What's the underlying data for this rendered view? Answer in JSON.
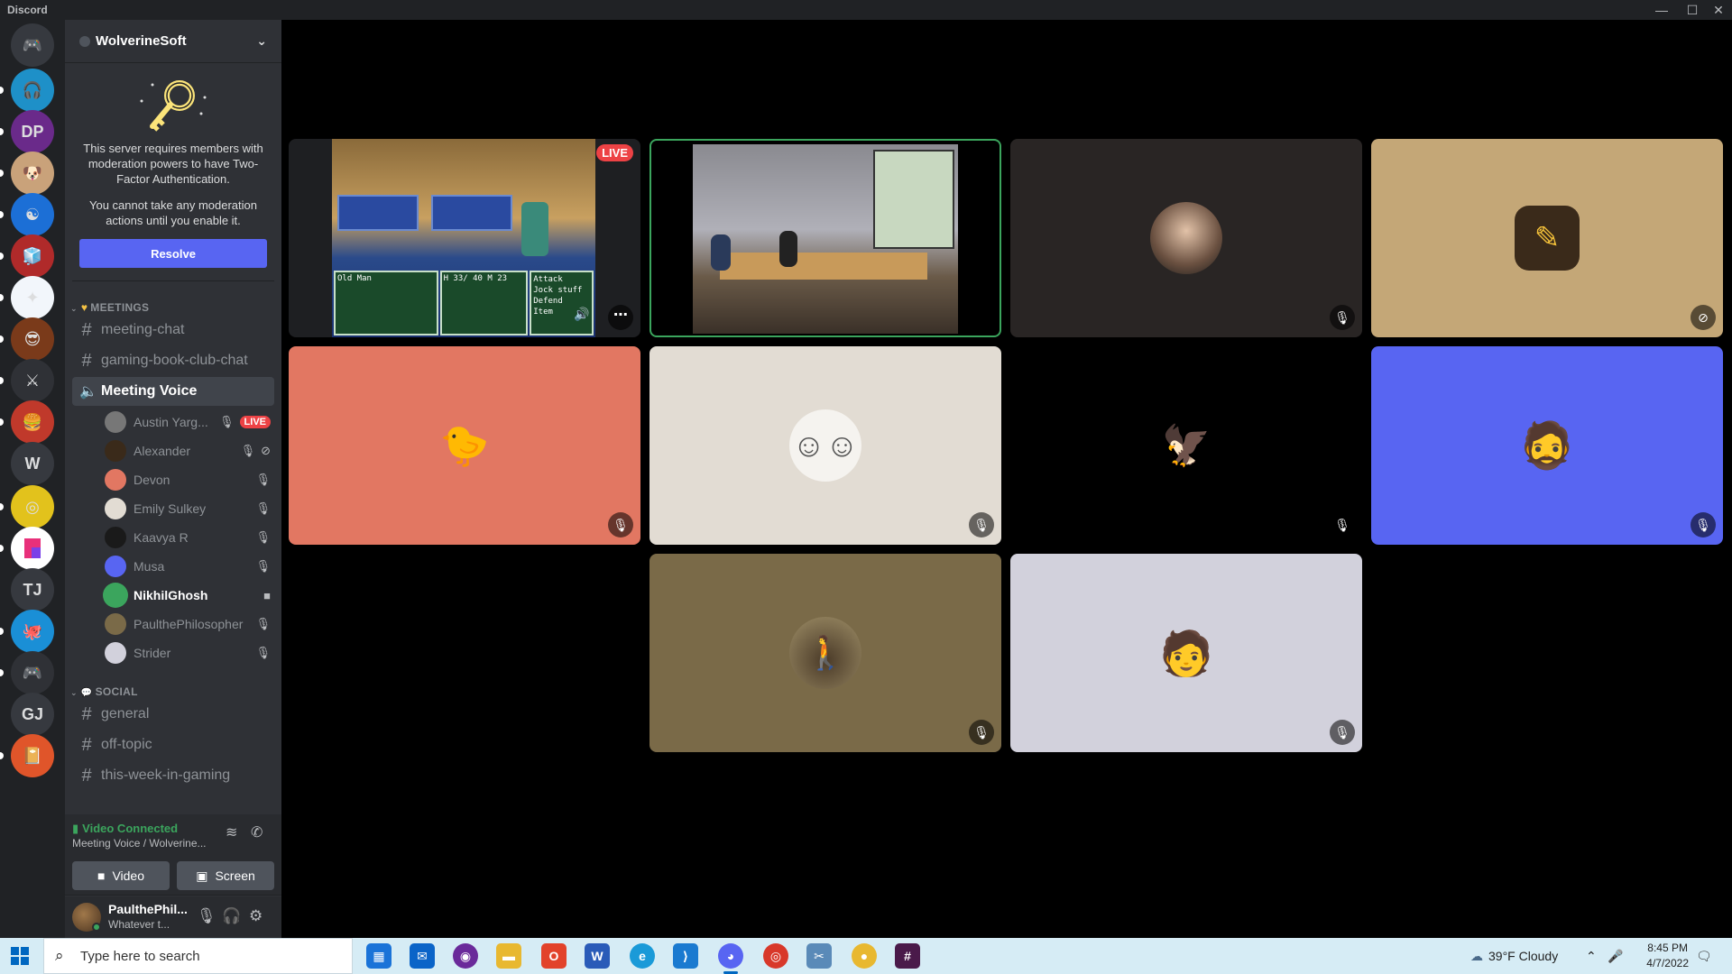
{
  "window": {
    "title": "Discord",
    "controls": [
      "—",
      "☐",
      "✕"
    ]
  },
  "guilds": [
    {
      "name": "guild-home",
      "label": "",
      "bg": "#36393f",
      "glyph": "🎮",
      "top": 0
    },
    {
      "label": "",
      "bg": "#1e90c8",
      "glyph": "🎧"
    },
    {
      "label": "DP",
      "bg": "#6a2a8a",
      "glyph": ""
    },
    {
      "label": "",
      "bg": "#c9a27a",
      "glyph": "🐶"
    },
    {
      "label": "",
      "bg": "#1c6fd6",
      "glyph": "☯"
    },
    {
      "label": "",
      "bg": "#b02a2a",
      "glyph": "🧊"
    },
    {
      "label": "",
      "bg": "#f2f6fb",
      "glyph": "✦"
    },
    {
      "label": "",
      "bg": "#7a3a1a",
      "glyph": "😎"
    },
    {
      "label": "",
      "bg": "#2f3136",
      "glyph": "⚔"
    },
    {
      "label": "",
      "bg": "#c0392b",
      "glyph": "🍔"
    },
    {
      "label": "W",
      "bg": "#36393f",
      "glyph": ""
    },
    {
      "label": "",
      "bg": "#e2c21c",
      "glyph": "◎"
    },
    {
      "label": "",
      "bg": "#ffffff",
      "glyph": ""
    },
    {
      "label": "TJ",
      "bg": "#36393f",
      "glyph": ""
    },
    {
      "label": "",
      "bg": "#1a8fd6",
      "glyph": "🐙"
    },
    {
      "label": "",
      "bg": "#2f3136",
      "glyph": "🎮"
    },
    {
      "label": "GJ",
      "bg": "#36393f",
      "glyph": ""
    },
    {
      "label": "",
      "bg": "#e0552a",
      "glyph": "📔"
    }
  ],
  "server": {
    "name": "WolverineSoft",
    "notice_1": "This server requires members with moderation powers to have Two-Factor Authentication.",
    "notice_2": "You cannot take any moderation actions until you enable it.",
    "resolve_label": "Resolve"
  },
  "categories": {
    "meetings": "MEETINGS",
    "social": "SOCIAL"
  },
  "channels": {
    "meeting_chat": "meeting-chat",
    "gaming_book_club": "gaming-book-club-chat",
    "meeting_voice": "Meeting Voice",
    "general": "general",
    "off_topic": "off-topic",
    "this_week": "this-week-in-gaming"
  },
  "voice_users": [
    {
      "name": "Austin Yarg...",
      "live": "LIVE"
    },
    {
      "name": "Alexander"
    },
    {
      "name": "Devon"
    },
    {
      "name": "Emily Sulkey"
    },
    {
      "name": "Kaavya R"
    },
    {
      "name": "Musa"
    },
    {
      "name": "NikhilGhosh"
    },
    {
      "name": "PaulthePhilosopher"
    },
    {
      "name": "Strider"
    }
  ],
  "rtc": {
    "status": "Video Connected",
    "location": "Meeting Voice / Wolverine...",
    "video_label": "Video",
    "screen_label": "Screen"
  },
  "user": {
    "name": "PaulthePhil...",
    "custom_status": "Whatever t..."
  },
  "stream": {
    "live_label": "LIVE",
    "battle_menu": [
      "Old Man",
      "H 33/ 40 M 23",
      "Attack",
      "Jock stuff",
      "Defend",
      "Item"
    ]
  },
  "tiles_colors": {
    "speaking_border": "#3ba55d",
    "alexander_bg": "#c4a777",
    "devon_bg": "#e27762",
    "emily_bg": "#e2dcd3",
    "musa_bg": "#5865f2",
    "paul_bg": "#7a6a48",
    "strider_bg": "#d2d1dc"
  },
  "taskbar": {
    "search_placeholder": "Type here to search",
    "weather": "39°F  Cloudy",
    "time": "8:45 PM",
    "date": "4/7/2022"
  }
}
